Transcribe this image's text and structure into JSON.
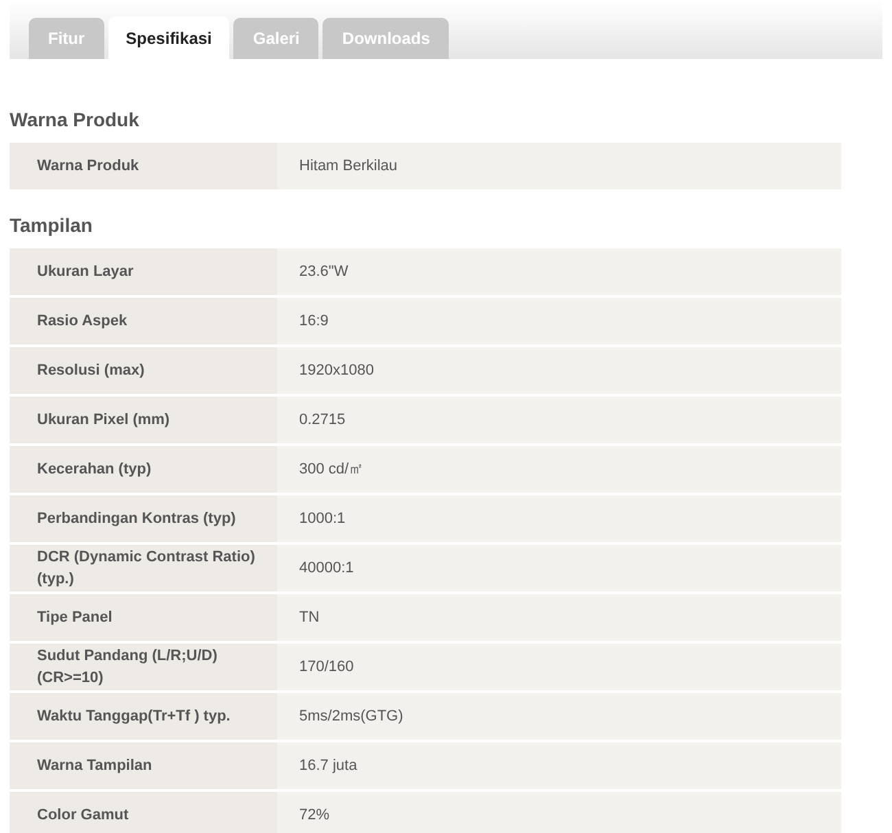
{
  "tabs": [
    {
      "label": "Fitur",
      "selected": false
    },
    {
      "label": "Spesifikasi",
      "selected": true
    },
    {
      "label": "Galeri",
      "selected": false
    },
    {
      "label": "Downloads",
      "selected": false
    }
  ],
  "sections": [
    {
      "title": "Warna Produk",
      "rows": [
        {
          "label": "Warna Produk",
          "value": "Hitam Berkilau"
        }
      ]
    },
    {
      "title": "Tampilan",
      "rows": [
        {
          "label": "Ukuran Layar",
          "value": "23.6\"W"
        },
        {
          "label": "Rasio Aspek",
          "value": "16:9"
        },
        {
          "label": "Resolusi (max)",
          "value": "1920x1080"
        },
        {
          "label": "Ukuran Pixel (mm)",
          "value": "0.2715"
        },
        {
          "label": "Kecerahan (typ)",
          "value": "300 cd/㎡"
        },
        {
          "label": "Perbandingan Kontras (typ)",
          "value": "1000:1"
        },
        {
          "label": "DCR (Dynamic Contrast Ratio) (typ.)",
          "value": "40000:1"
        },
        {
          "label": "Tipe Panel",
          "value": "TN"
        },
        {
          "label": "Sudut Pandang (L/R;U/D) (CR>=10)",
          "value": "170/160"
        },
        {
          "label": "Waktu Tanggap(Tr+Tf ) typ.",
          "value": "5ms/2ms(GTG)"
        },
        {
          "label": "Warna Tampilan",
          "value": "16.7 juta"
        },
        {
          "label": "Color Gamut",
          "value": "72%"
        }
      ]
    }
  ]
}
